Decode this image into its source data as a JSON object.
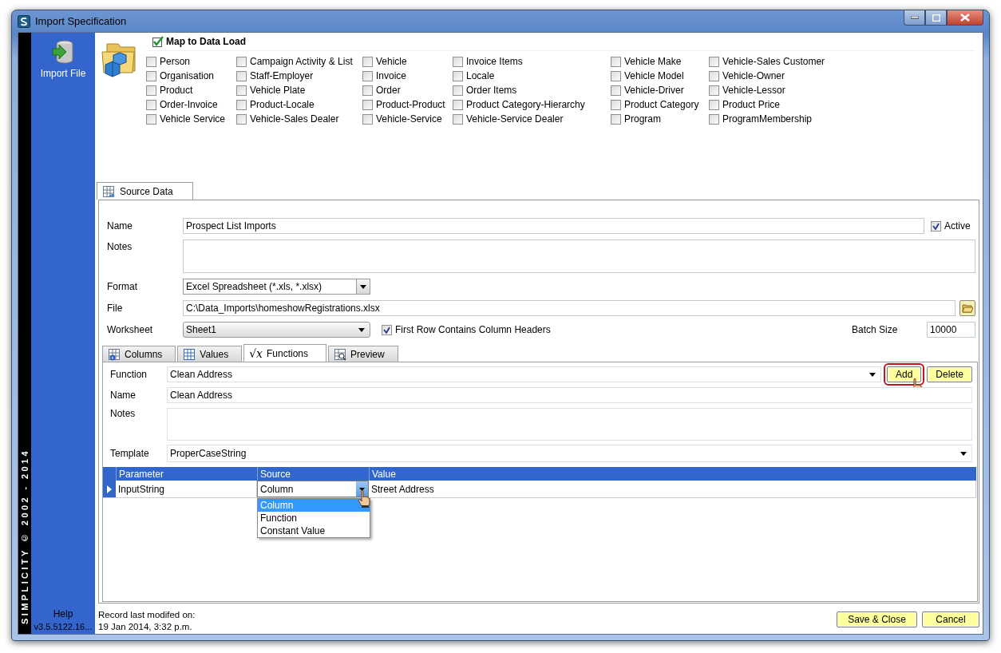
{
  "window": {
    "title": "Import Specification"
  },
  "sidebar": {
    "import_button": "Import File",
    "vertical_text": "SIMPLICITY © 2002 - 2014",
    "help": "Help",
    "version": "v3.5.5122.16..."
  },
  "map_to_data_load": {
    "title": "Map to Data Load",
    "columns": [
      [
        {
          "label": "Person",
          "checked": false
        },
        {
          "label": "Organisation",
          "checked": false
        },
        {
          "label": "Product",
          "checked": false
        },
        {
          "label": "Order-Invoice",
          "checked": false
        },
        {
          "label": "Vehicle Service",
          "checked": false
        }
      ],
      [
        {
          "label": "Campaign Activity & List",
          "checked": false
        },
        {
          "label": "Staff-Employer",
          "checked": false
        },
        {
          "label": "Vehicle Plate",
          "checked": false
        },
        {
          "label": "Product-Locale",
          "checked": false
        },
        {
          "label": "Vehicle-Sales Dealer",
          "checked": false
        }
      ],
      [
        {
          "label": "Vehicle",
          "checked": false
        },
        {
          "label": "Invoice",
          "checked": false
        },
        {
          "label": "Order",
          "checked": false
        },
        {
          "label": "Product-Product",
          "checked": false
        },
        {
          "label": "Vehicle-Service",
          "checked": false
        }
      ],
      [
        {
          "label": "Invoice Items",
          "checked": false
        },
        {
          "label": "Locale",
          "checked": false
        },
        {
          "label": "Order Items",
          "checked": false
        },
        {
          "label": "Product Category-Hierarchy",
          "checked": false
        },
        {
          "label": "Vehicle-Service Dealer",
          "checked": false
        }
      ],
      [
        {
          "label": "Vehicle Make",
          "checked": false
        },
        {
          "label": "Vehicle Model",
          "checked": false
        },
        {
          "label": "Vehicle-Driver",
          "checked": false
        },
        {
          "label": "Product Category",
          "checked": false
        },
        {
          "label": "Program",
          "checked": false
        }
      ],
      [
        {
          "label": "Vehicle-Sales Customer",
          "checked": false
        },
        {
          "label": "Vehicle-Owner",
          "checked": false
        },
        {
          "label": "Vehicle-Lessor",
          "checked": false
        },
        {
          "label": "Product Price",
          "checked": false
        },
        {
          "label": "ProgramMembership",
          "checked": false
        }
      ]
    ]
  },
  "tabs": [
    {
      "label": "Source Data",
      "selected": true
    }
  ],
  "source_data": {
    "name_label": "Name",
    "name": "Prospect List Imports",
    "active": {
      "label": "Active",
      "checked": true
    },
    "notes_label": "Notes",
    "format_label": "Format",
    "format": "Excel Spreadsheet (*.xls, *.xlsx)",
    "file_label": "File",
    "file": "C:\\Data_Imports\\homeshowRegistrations.xlsx",
    "worksheet_label": "Worksheet",
    "worksheet": "Sheet1",
    "first_row_headers": {
      "label": "First Row Contains Column Headers",
      "checked": true
    },
    "batch_size_label": "Batch Size",
    "batch_size": "10000"
  },
  "inner_tabs": [
    {
      "label": "Columns",
      "kind": "grid-info",
      "selected": false
    },
    {
      "label": "Values",
      "kind": "grid",
      "selected": false
    },
    {
      "label": "Functions",
      "kind": "formula",
      "symbol": "√x",
      "selected": true
    },
    {
      "label": "Preview",
      "kind": "preview",
      "selected": false
    }
  ],
  "functions": {
    "function_label": "Function",
    "function": "Clean Address",
    "add_button": {
      "label": "Add",
      "highlighted": true
    },
    "delete_button": {
      "label": "Delete"
    },
    "name_label": "Name",
    "name": "Clean Address",
    "notes_label": "Notes",
    "template_label": "Template",
    "template": "ProperCaseString",
    "grid": {
      "columns": [
        "Parameter",
        "Source",
        "Value"
      ],
      "rows": [
        {
          "parameter": "InputString",
          "source": "Column",
          "value": "Street Address",
          "selected": true
        }
      ]
    },
    "source_dropdown": {
      "options": [
        {
          "label": "Column",
          "selected": true
        },
        {
          "label": "Function",
          "selected": false
        },
        {
          "label": "Constant Value",
          "selected": false
        }
      ]
    }
  },
  "status": {
    "label": "Record last modifed on:",
    "date": "19 Jan 2014, 3:32 p.m."
  },
  "buttons": {
    "save": "Save & Close",
    "cancel": "Cancel"
  }
}
